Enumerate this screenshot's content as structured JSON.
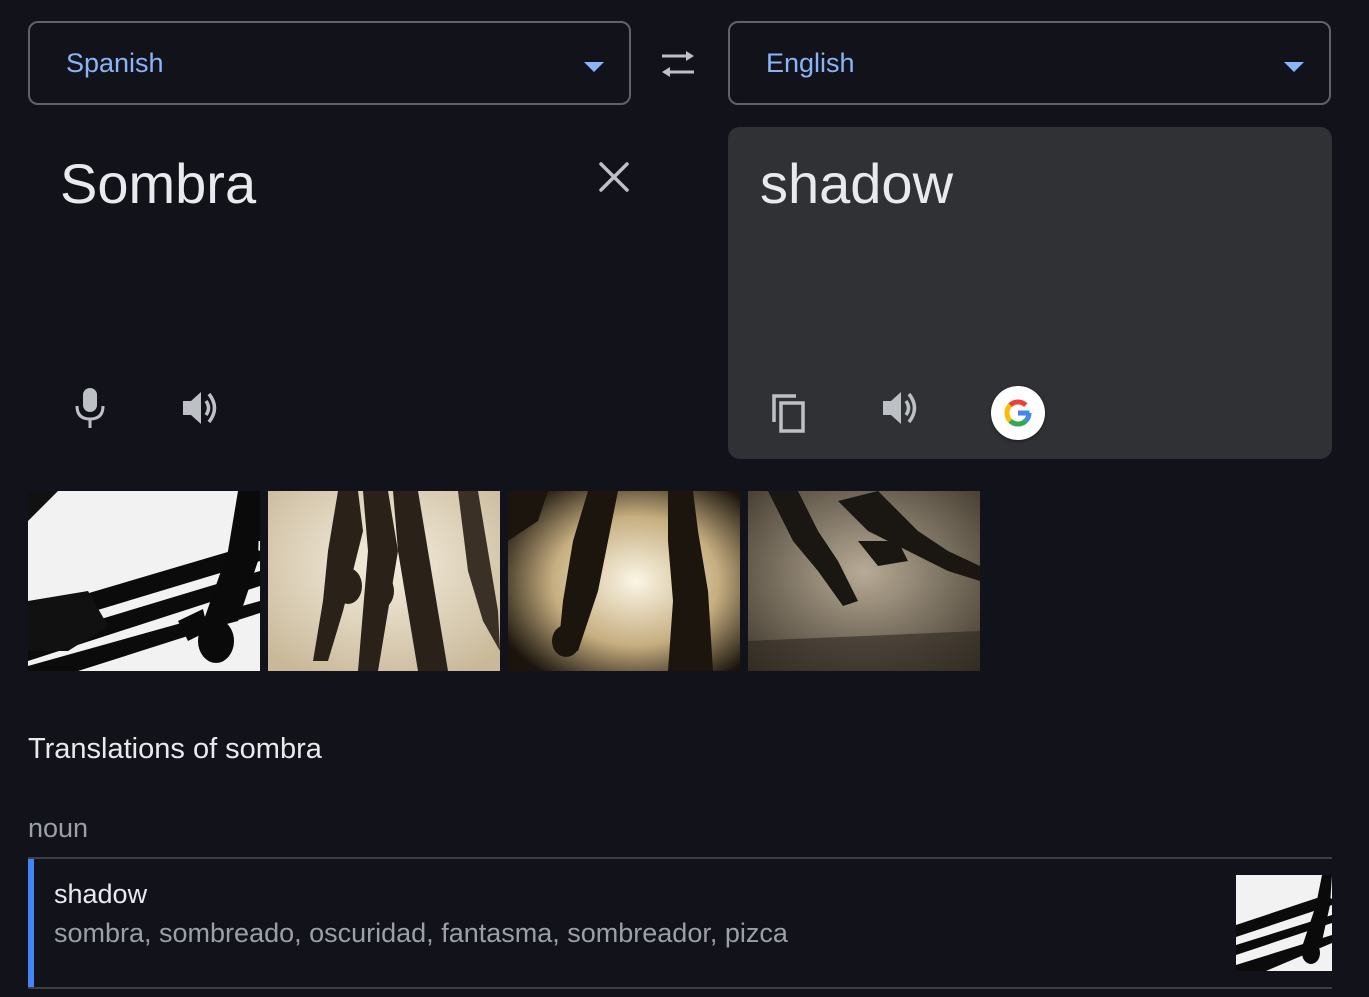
{
  "source_language": {
    "label": "Spanish",
    "icon": "chevron-down-icon"
  },
  "target_language": {
    "label": "English",
    "icon": "chevron-down-icon"
  },
  "swap": {
    "icon": "swap-arrows-icon"
  },
  "source": {
    "text": "Sombra",
    "clear_icon": "close-icon",
    "mic_icon": "microphone-icon",
    "listen_icon": "speaker-icon"
  },
  "target": {
    "text": "shadow",
    "copy_icon": "copy-icon",
    "listen_icon": "speaker-icon",
    "search_icon": "google-logo-icon"
  },
  "images": [
    "shadow-image-1",
    "shadow-image-2",
    "shadow-image-3",
    "shadow-image-4"
  ],
  "translations": {
    "title": "Translations of sombra",
    "part_of_speech": "noun",
    "entries": [
      {
        "word": "shadow",
        "synonyms": "sombra, sombreado, oscuridad, fantasma, sombreador, pizca"
      }
    ]
  },
  "colors": {
    "background": "#12131a",
    "accent": "#8ab4f8",
    "panel": "#303134",
    "entry_accent": "#4285f4"
  }
}
